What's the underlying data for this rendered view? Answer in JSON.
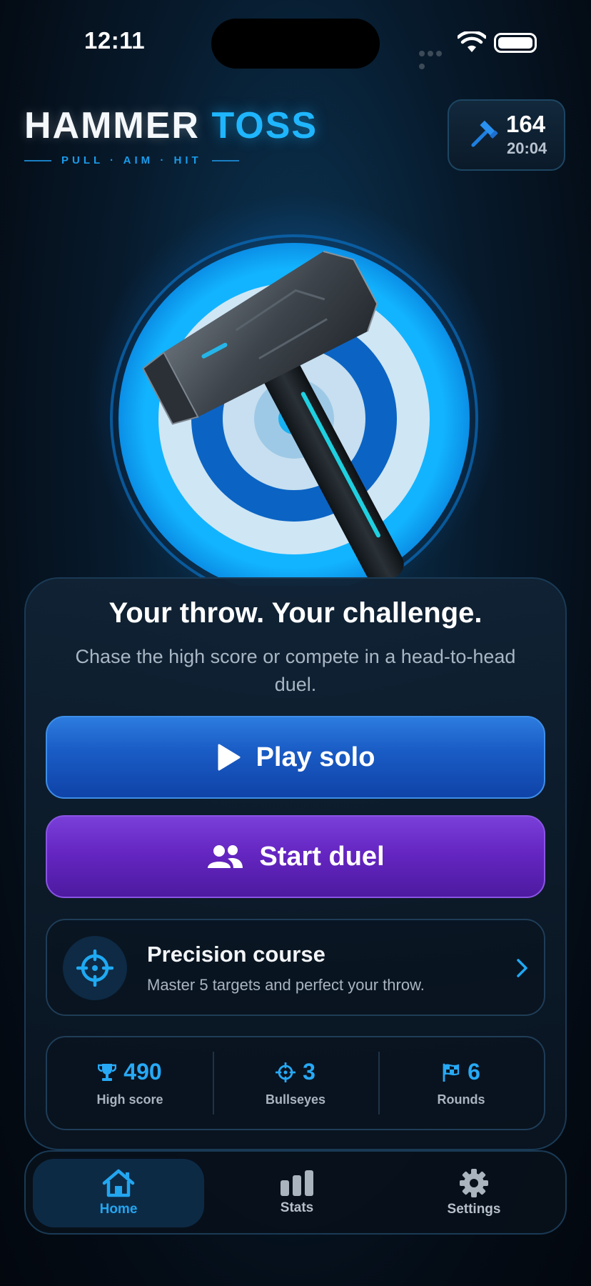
{
  "status_bar": {
    "time": "12:11"
  },
  "header": {
    "title_word_1": "HAMMER",
    "title_word_2": "TOSS",
    "tagline": "PULL · AIM · HIT"
  },
  "counter": {
    "count": "164",
    "timer": "20:04",
    "icon": "hammer-icon"
  },
  "hero": {
    "image": "hammer-over-target"
  },
  "card": {
    "title": "Your throw. Your challenge.",
    "subtitle": "Chase the high score or compete in a head-to-head duel."
  },
  "buttons": {
    "solo": {
      "label": "Play solo",
      "icon": "play-icon"
    },
    "duel": {
      "label": "Start duel",
      "icon": "users-icon"
    }
  },
  "course": {
    "title": "Precision course",
    "description": "Master 5 targets and perfect your throw.",
    "icon": "crosshair-icon"
  },
  "stats": [
    {
      "value": "490",
      "label": "High score",
      "icon": "trophy-icon"
    },
    {
      "value": "3",
      "label": "Bullseyes",
      "icon": "crosshair-icon"
    },
    {
      "value": "6",
      "label": "Rounds",
      "icon": "checkered-flag-icon"
    }
  ],
  "tabs": [
    {
      "label": "Home",
      "icon": "home-icon",
      "active": true
    },
    {
      "label": "Stats",
      "icon": "bar-chart-icon",
      "active": false
    },
    {
      "label": "Settings",
      "icon": "gear-icon",
      "active": false
    }
  ],
  "colors": {
    "accent": "#1fb6ff",
    "solo_button": "#1a5dc6",
    "duel_button": "#6526c2",
    "background": "#071a2c"
  }
}
